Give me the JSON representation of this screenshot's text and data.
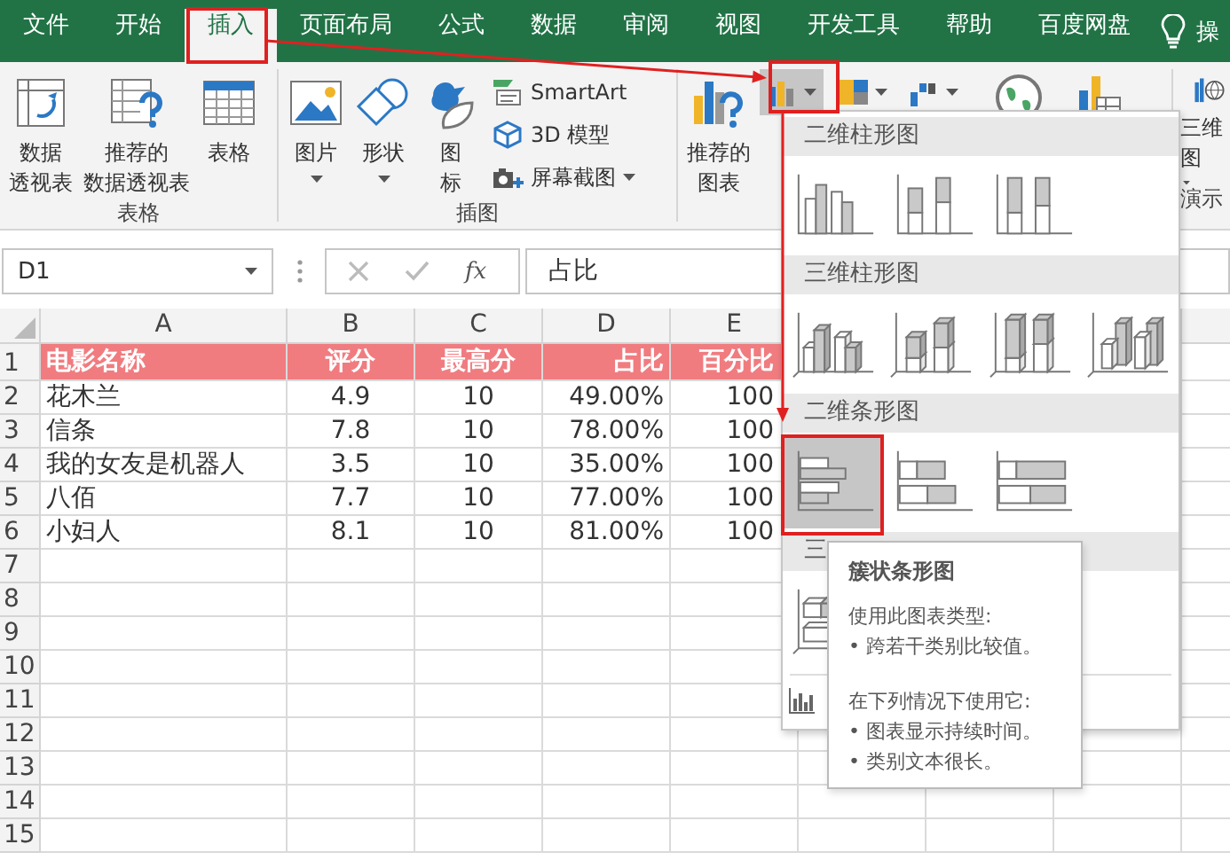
{
  "tabs": [
    {
      "label": "文件",
      "selected": false
    },
    {
      "label": "开始",
      "selected": false
    },
    {
      "label": "插入",
      "selected": true
    },
    {
      "label": "页面布局",
      "selected": false
    },
    {
      "label": "公式",
      "selected": false
    },
    {
      "label": "数据",
      "selected": false
    },
    {
      "label": "审阅",
      "selected": false
    },
    {
      "label": "视图",
      "selected": false
    },
    {
      "label": "开发工具",
      "selected": false
    },
    {
      "label": "帮助",
      "selected": false
    },
    {
      "label": "百度网盘",
      "selected": false
    }
  ],
  "tell_me": "操",
  "ribbon": {
    "groups": [
      {
        "label": "表格",
        "large_buttons": [
          {
            "lines": [
              "数据",
              "透视表"
            ],
            "dropdown": false
          },
          {
            "lines": [
              "推荐的",
              "数据透视表"
            ],
            "dropdown": false
          },
          {
            "lines": [
              "表格"
            ],
            "dropdown": false
          }
        ]
      },
      {
        "label": "插图",
        "large_buttons": [
          {
            "lines": [
              "图片"
            ],
            "dropdown": true
          },
          {
            "lines": [
              "形状"
            ],
            "dropdown": true
          },
          {
            "lines": [
              "图",
              "标"
            ],
            "dropdown": false
          }
        ],
        "small_buttons": [
          {
            "label": "SmartArt",
            "dropdown": false
          },
          {
            "label": "3D 模型",
            "dropdown": false
          },
          {
            "label": "屏幕截图",
            "dropdown": true
          }
        ]
      },
      {
        "large_buttons": [
          {
            "lines": [
              "推荐的",
              "图表"
            ],
            "dropdown": false
          }
        ],
        "chart_buttons": [
          {
            "selected": true
          },
          {
            "selected": false
          },
          {
            "selected": false
          }
        ]
      },
      {
        "label": "演示",
        "large_buttons": [
          {
            "lines": [
              "三维",
              "图"
            ],
            "dropdown": true
          }
        ]
      }
    ]
  },
  "formula_bar": {
    "name_box": "D1",
    "function_label": "fx",
    "formula": "占比"
  },
  "sheet": {
    "columns": [
      "A",
      "B",
      "C",
      "D",
      "E"
    ],
    "rows": [
      {
        "number": "1",
        "kind": "header",
        "cells": [
          "电影名称",
          "评分",
          "最高分",
          "占比",
          "百分比"
        ]
      },
      {
        "number": "2",
        "kind": "data",
        "cells": [
          "花木兰",
          "4.9",
          "10",
          "49.00%",
          "100"
        ]
      },
      {
        "number": "3",
        "kind": "data",
        "cells": [
          "信条",
          "7.8",
          "10",
          "78.00%",
          "100"
        ]
      },
      {
        "number": "4",
        "kind": "data",
        "cells": [
          "我的女友是机器人",
          "3.5",
          "10",
          "35.00%",
          "100"
        ]
      },
      {
        "number": "5",
        "kind": "data",
        "cells": [
          "八佰",
          "7.7",
          "10",
          "77.00%",
          "100"
        ]
      },
      {
        "number": "6",
        "kind": "data",
        "cells": [
          "小妇人",
          "8.1",
          "10",
          "81.00%",
          "100"
        ]
      },
      {
        "number": "7",
        "kind": "data"
      },
      {
        "number": "8",
        "kind": "data"
      },
      {
        "number": "9",
        "kind": "data"
      },
      {
        "number": "10",
        "kind": "data"
      },
      {
        "number": "11",
        "kind": "data"
      },
      {
        "number": "12",
        "kind": "data"
      },
      {
        "number": "13",
        "kind": "data"
      },
      {
        "number": "14",
        "kind": "data"
      },
      {
        "number": "15",
        "kind": "data"
      }
    ]
  },
  "chart_gallery": {
    "sections": [
      {
        "kind": "column2d",
        "title": "二维柱形图",
        "items": [
          {
            "selected": false
          },
          {
            "selected": false
          },
          {
            "selected": false
          }
        ]
      },
      {
        "kind": "column3d",
        "title": "三维柱形图",
        "items": [
          {
            "selected": false
          },
          {
            "selected": false
          },
          {
            "selected": false
          },
          {
            "selected": false
          }
        ]
      },
      {
        "kind": "bar2d",
        "title": "二维条形图",
        "items": [
          {
            "selected": true
          },
          {
            "selected": false
          },
          {
            "selected": false
          }
        ]
      },
      {
        "kind": "bar3d",
        "title": "三",
        "items": [
          {
            "selected": false
          }
        ]
      }
    ]
  },
  "tooltip": {
    "title": "簇状条形图",
    "paragraphs": [
      {
        "heading": "使用此图表类型:",
        "bullets": [
          "• 跨若干类别比较值。"
        ]
      },
      {
        "heading": "在下列情况下使用它:",
        "bullets": [
          "• 图表显示持续时间。",
          "• 类别文本很长。"
        ]
      }
    ]
  }
}
